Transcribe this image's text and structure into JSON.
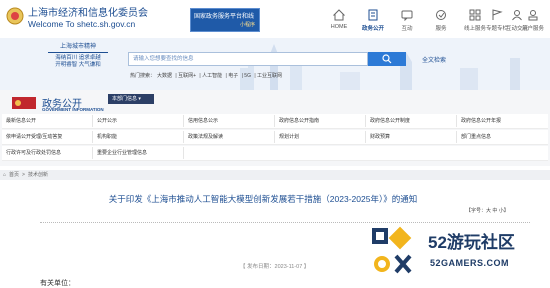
{
  "header": {
    "site_name_cn": "上海市经济和信息化委员会",
    "site_name_en": "Welcome To shetc.sh.gov.cn",
    "banner_line1": "国家政务服务平台和线",
    "banner_line2": "小程序",
    "nav": [
      {
        "label": "HOME"
      },
      {
        "label": "政务公开"
      },
      {
        "label": "互动"
      },
      {
        "label": "服务"
      },
      {
        "label": "线上服务"
      },
      {
        "label": "专题专栏"
      },
      {
        "label": "互动交流"
      },
      {
        "label": "用户服务"
      }
    ]
  },
  "hero": {
    "slogan_title": "上海城市精神",
    "slogan_line1": "海纳百川 追求卓越",
    "slogan_line2": "开明睿智 大气谦和",
    "search_placeholder": "请输入您想要查找的信息",
    "full_search": "全文检索",
    "hotwords_label": "热门搜索：",
    "hotwords": [
      "大数据",
      "互联网+",
      "人工智能",
      "电子",
      "5G",
      "工业互联网"
    ]
  },
  "gov": {
    "title": "政务公开",
    "subtitle": "GOVERMENT INFORMATION",
    "dropdown": "本部门信息",
    "rows": [
      [
        "最新信息公开",
        "公开公示",
        "信用信息公示",
        "政府信息公开指南",
        "政府信息公开制度",
        "政府信息公开年报"
      ],
      [
        "依申请公开受理/互动答复",
        "机构职能",
        "政策法规及解读",
        "规划计划",
        "财政预算",
        "部门重点信息"
      ],
      [
        "行政许可及行政处罚信息",
        "重要企业行业管理信息"
      ]
    ]
  },
  "breadcrumb": [
    "首页",
    "技术创新"
  ],
  "article": {
    "title": "关于印发《上海市推动人工智能大模型创新发展若干措施（2023-2025年）》的通知",
    "font_ctrl": "【字号：大 中 小】",
    "pub_date": "【 发布日期：2023-11-07 】",
    "recipient": "有关单位："
  },
  "watermark": {
    "cn": "52游玩社区",
    "en": "52GAMERS.COM"
  }
}
